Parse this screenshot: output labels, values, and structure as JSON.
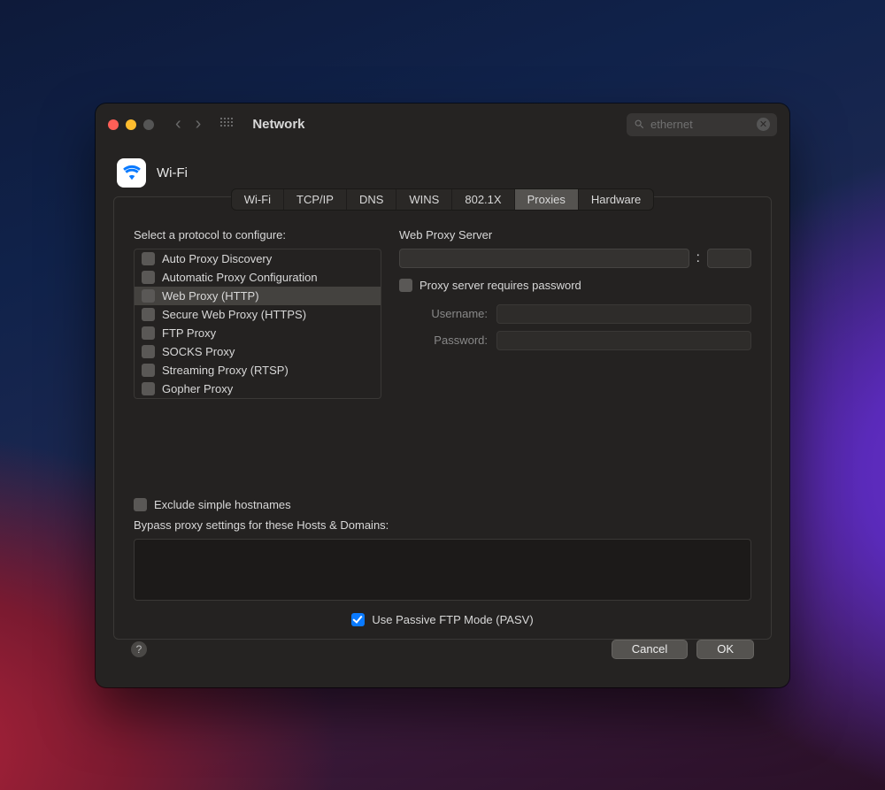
{
  "titlebar": {
    "title": "Network",
    "search_text": "ethernet"
  },
  "header": {
    "interface": "Wi-Fi"
  },
  "tabs": [
    "Wi-Fi",
    "TCP/IP",
    "DNS",
    "WINS",
    "802.1X",
    "Proxies",
    "Hardware"
  ],
  "left": {
    "label": "Select a protocol to configure:",
    "protocols": [
      "Auto Proxy Discovery",
      "Automatic Proxy Configuration",
      "Web Proxy (HTTP)",
      "Secure Web Proxy (HTTPS)",
      "FTP Proxy",
      "SOCKS Proxy",
      "Streaming Proxy (RTSP)",
      "Gopher Proxy"
    ]
  },
  "right": {
    "server_label": "Web Proxy Server",
    "requires_password": "Proxy server requires password",
    "username_label": "Username:",
    "password_label": "Password:"
  },
  "lower": {
    "exclude_simple": "Exclude simple hostnames",
    "bypass_label": "Bypass proxy settings for these Hosts & Domains:",
    "pasv": "Use Passive FTP Mode (PASV)"
  },
  "footer": {
    "cancel": "Cancel",
    "ok": "OK"
  }
}
